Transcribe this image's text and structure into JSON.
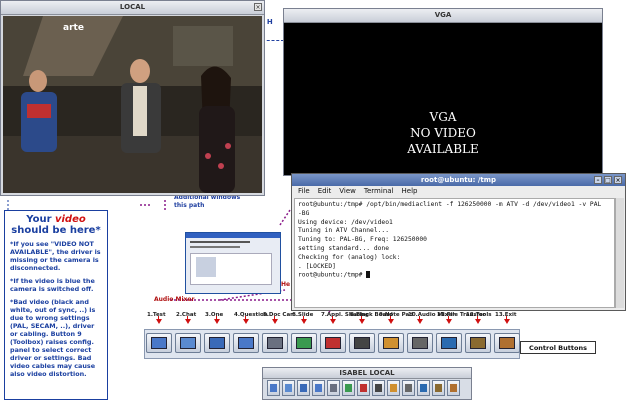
{
  "local_window": {
    "title": "LOCAL",
    "video_logo": "arte"
  },
  "vga_window": {
    "title": "VGA",
    "message_lines": [
      "VGA",
      "NO VIDEO",
      "AVAILABLE"
    ]
  },
  "terminal": {
    "title": "root@ubuntu: /tmp",
    "menu": [
      "File",
      "Edit",
      "View",
      "Terminal",
      "Help"
    ],
    "lines": [
      "root@ubuntu:/tmp# /opt/bin/mediaclient -f 126250000 -m ATV -d /dev/video1 -v PAL",
      "-BG",
      "Using device: /dev/video1",
      "Tuning in ATV Channel...",
      "Tuning to: PAL-BG, Freq: 126250000",
      "setting standard... done",
      "Checking for (analog) lock:",
      ". [LOCKED]",
      "root@ubuntu:/tmp# "
    ]
  },
  "help_panel": {
    "heading_prefix": "Your ",
    "heading_em": "video",
    "heading_line2": "should be here*",
    "paragraphs": [
      "*If you see \"VIDEO NOT AVAILABLE\", the driver is missing or the camera is disconnected.",
      "*If the video is blue the camera is switched off.",
      "*Bad video (black and white, out of sync, ..) is due to wrong settings (PAL, SECAM, ..), driver or cabling. Button 9 (Toolbox) raises config. panel to select correct driver or settings. Bad video cables may cause also video distortion."
    ]
  },
  "annotations": {
    "top_fragment": "l H",
    "mid_fragment1": "Additional windows",
    "mid_fragment2": "this path",
    "audio_mixer_label": "Audio Mixer",
    "he_fragment": "He"
  },
  "toolbar": {
    "items": [
      {
        "label": "1.Test",
        "icon": "monitor-icon"
      },
      {
        "label": "2.Chat",
        "icon": "chat-icon"
      },
      {
        "label": "3.One",
        "icon": "one-icon"
      },
      {
        "label": "4.Question",
        "icon": "question-icon"
      },
      {
        "label": "5.Doc Cam.",
        "icon": "doc-cam-icon"
      },
      {
        "label": "6.Slide",
        "icon": "slide-icon"
      },
      {
        "label": "7.Appl. Sharing",
        "icon": "app-sharing-icon"
      },
      {
        "label": "8.Black Board",
        "icon": "blackboard-icon"
      },
      {
        "label": "9.Note Pad",
        "icon": "notepad-icon"
      },
      {
        "label": "10.Audio Mixer",
        "icon": "audio-mixer-icon"
      },
      {
        "label": "11.File Transfer",
        "icon": "file-transfer-icon"
      },
      {
        "label": "12.Tools",
        "icon": "tools-icon"
      },
      {
        "label": "13.Exit",
        "icon": "exit-icon"
      }
    ],
    "control_buttons_label": "Control Buttons"
  },
  "isabel_local": {
    "title": "ISABEL LOCAL"
  }
}
